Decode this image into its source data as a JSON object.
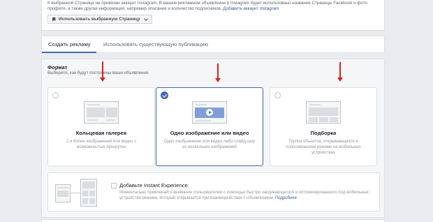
{
  "top_notice": {
    "text": "К выбранной Странице не привязан аккаунт Instagram. В вашем рекламном объявлении в Instagram будет использовано название Страницы Facebook и фото профиля, а также другая информация, например описание и количество подписчиков.",
    "link": "Добавить аккаунт Instagram",
    "button_label": "Использовать выбранную Страницу"
  },
  "tabs": [
    {
      "label": "Создать рекламу",
      "active": true
    },
    {
      "label": "Использовать существующую публикацию",
      "active": false
    }
  ],
  "format": {
    "title": "Формат",
    "subtitle": "Выберите, как будут построены ваши объявления.",
    "options": [
      {
        "title": "Кольцевая галерея",
        "description": "2 и более изображений или видео с возможностью прокрутки",
        "selected": false,
        "icon": "carousel-icon"
      },
      {
        "title": "Одно изображение или видео",
        "description": "Одно изображение или видео либо слайд-шоу из нескольких изображений",
        "selected": true,
        "icon": "single-image-video-icon"
      },
      {
        "title": "Подборка",
        "description": "Группа объектов, открывающихся в полноэкранном режиме на мобильных устройствах",
        "selected": false,
        "icon": "collection-icon"
      }
    ]
  },
  "instant_experience": {
    "title": "Добавьте Instant Experience",
    "description": "Моментально привлекайте внимание пользователей с помощью быстро загружающегося и оптимизированного под мобильные устройства режима, который открывается при взаимодействии с объявлением.",
    "link": "Подробнее"
  },
  "colors": {
    "accent": "#4267b2",
    "annotation_arrow": "#e02020",
    "background": "#e9ebee"
  }
}
